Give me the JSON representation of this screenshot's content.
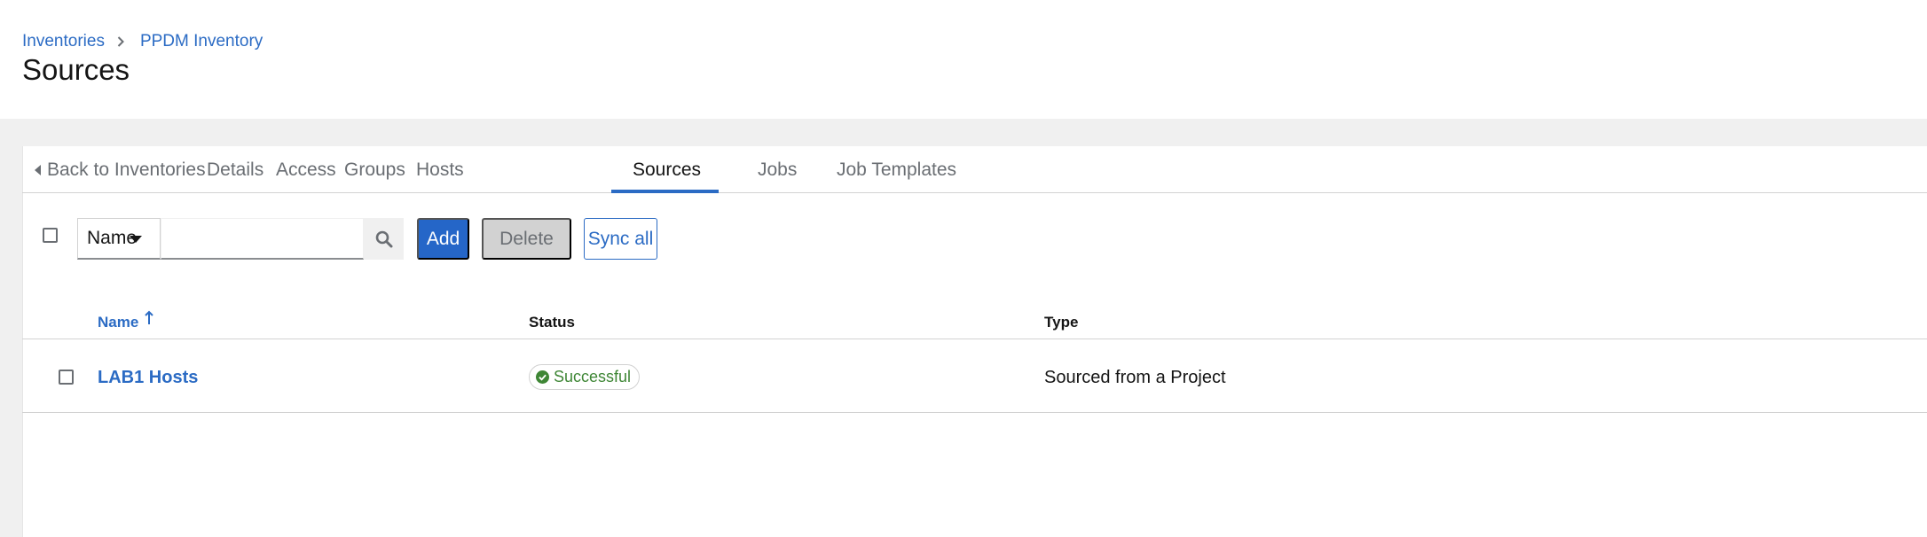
{
  "breadcrumb": {
    "items": [
      "Inventories",
      "PPDM Inventory"
    ]
  },
  "page": {
    "title": "Sources"
  },
  "tabs": [
    {
      "label": "Back to Inventories",
      "active": false
    },
    {
      "label": "Details",
      "active": false
    },
    {
      "label": "Access",
      "active": false
    },
    {
      "label": "Groups",
      "active": false
    },
    {
      "label": "Hosts",
      "active": false
    },
    {
      "label": "Sources",
      "active": true
    },
    {
      "label": "Jobs",
      "active": false
    },
    {
      "label": "Job Templates",
      "active": false
    }
  ],
  "toolbar": {
    "filter_selected": "Name",
    "search_value": "",
    "search_icon": "search-icon",
    "add_label": "Add",
    "delete_label": "Delete",
    "sync_label": "Sync all"
  },
  "table": {
    "columns": [
      "Name",
      "Status",
      "Type"
    ],
    "sort": {
      "column": "Name",
      "direction": "ascending"
    },
    "rows": [
      {
        "name": "LAB1 Hosts",
        "status": "Successful",
        "type": "Sourced from a Project"
      }
    ]
  },
  "colors": {
    "accent": "#2b6bc4",
    "primary_button": "#2566c8",
    "success": "#3e8635",
    "page_background": "#f0f0f0"
  }
}
